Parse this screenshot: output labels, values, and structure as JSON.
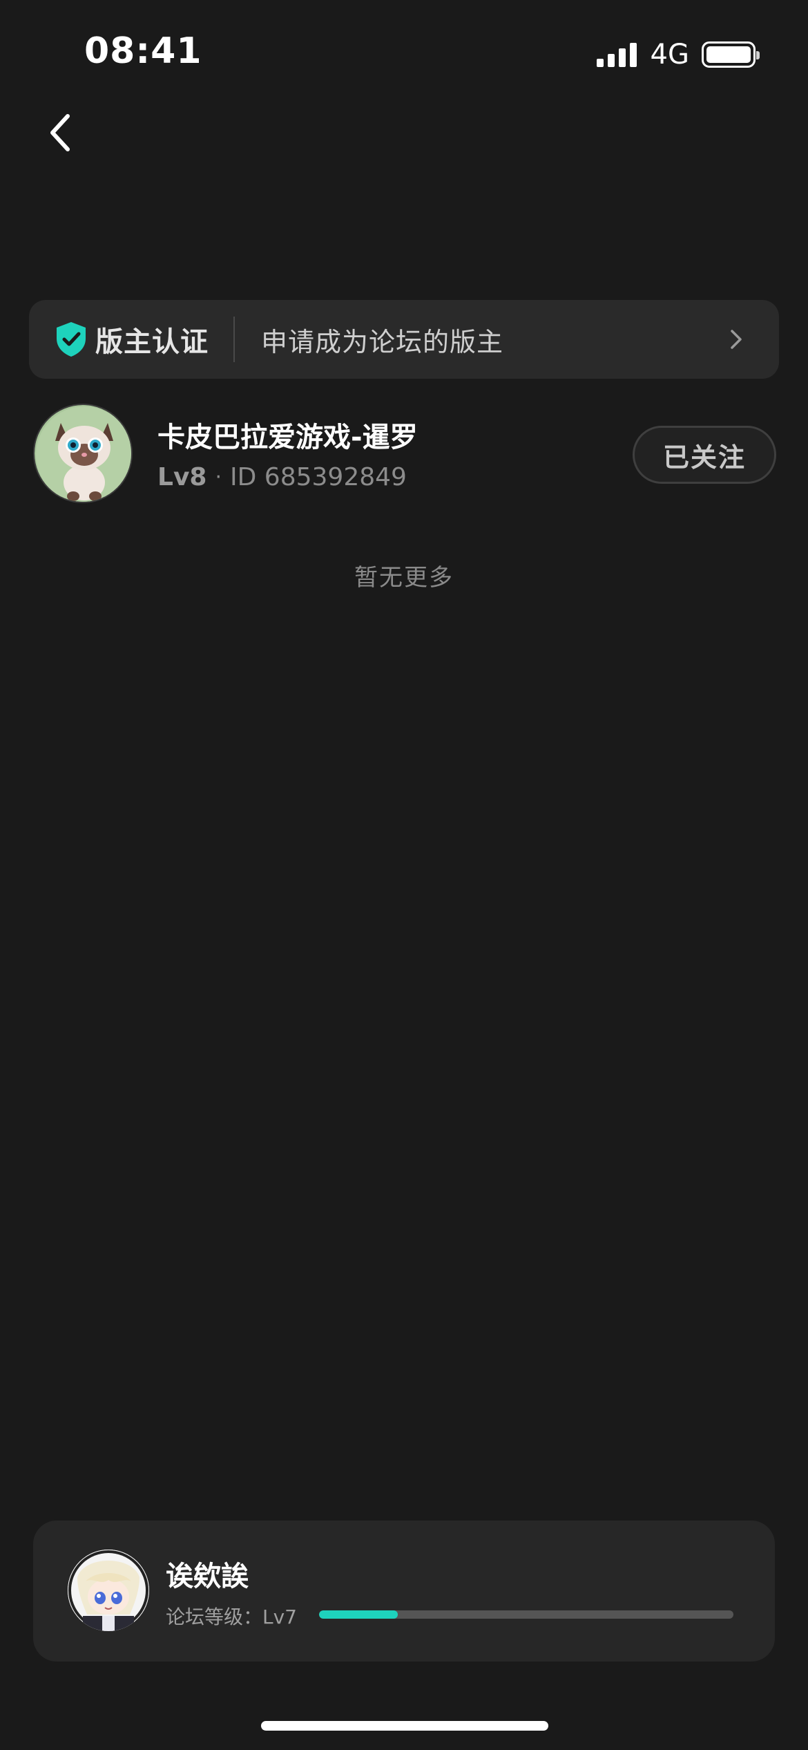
{
  "status_bar": {
    "time": "08:41",
    "network": "4G",
    "icons": [
      "signal-icon",
      "battery-icon"
    ]
  },
  "nav": {
    "back_icon": "chevron-left-icon"
  },
  "moderator_banner": {
    "icon": "shield-check-icon",
    "title": "版主认证",
    "text": "申请成为论坛的版主",
    "chevron_icon": "chevron-right-icon",
    "accent": "#1ed2bc"
  },
  "moderators": [
    {
      "name": "卡皮巴拉爱游戏-暹罗",
      "level": "Lv8",
      "separator": "·",
      "id_text": "ID 685392849",
      "follow_label": "已关注"
    }
  ],
  "list_end_text": "暂无更多",
  "my_card": {
    "name": "诶欸誒",
    "level_label": "论坛等级：Lv7",
    "progress": 0.19,
    "progress_color": "#1ed2bc"
  }
}
